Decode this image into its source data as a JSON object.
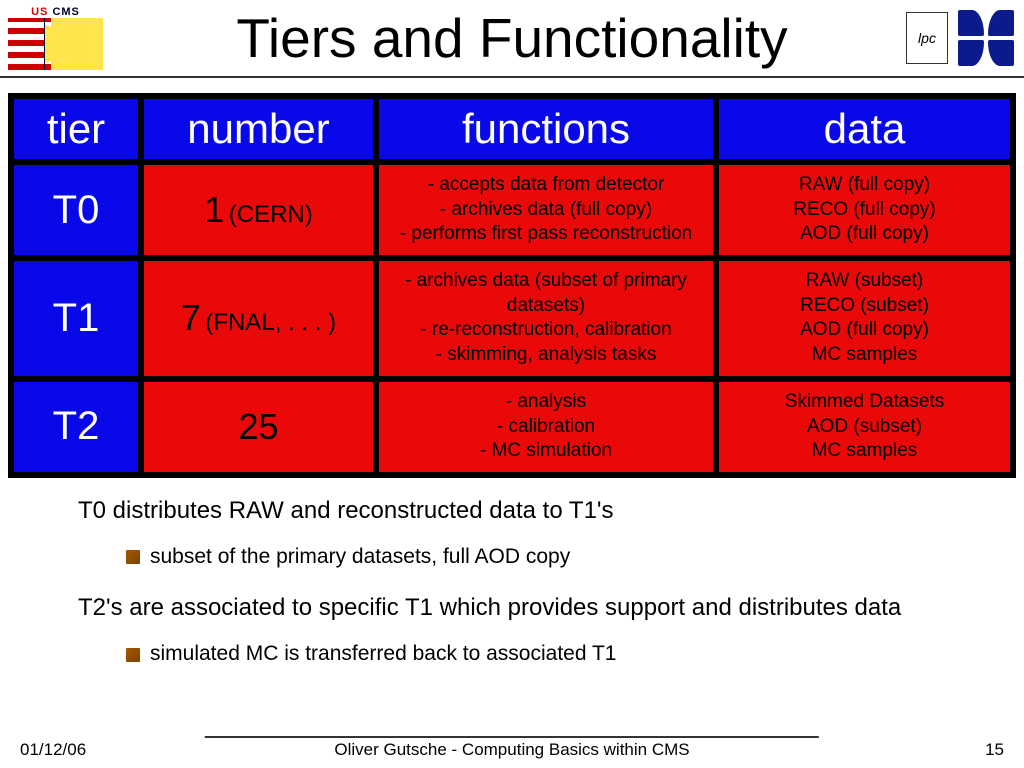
{
  "header": {
    "logo_text": "US CMS",
    "title": "Tiers and Functionality",
    "lpc": "lpc"
  },
  "table": {
    "headers": {
      "c0": "tier",
      "c1": "number",
      "c2": "functions",
      "c3": "data"
    },
    "rows": [
      {
        "tier": "T0",
        "num_main": "1",
        "num_sub": "(CERN)",
        "functions": "- accepts data from detector\n- archives data (full copy)\n- performs first pass reconstruction",
        "data": "RAW (full copy)\nRECO (full copy)\nAOD (full copy)"
      },
      {
        "tier": "T1",
        "num_main": "7",
        "num_sub": "(FNAL, . . . )",
        "functions": "- archives data (subset of primary datasets)\n- re-reconstruction, calibration\n- skimming, analysis tasks",
        "data": "RAW (subset)\nRECO (subset)\nAOD (full copy)\nMC samples"
      },
      {
        "tier": "T2",
        "num_main": "25",
        "num_sub": "",
        "functions": "- analysis\n- calibration\n- MC simulation",
        "data": "Skimmed Datasets\nAOD (subset)\nMC samples"
      }
    ]
  },
  "below": {
    "l1": "T0 distributes RAW and reconstructed data to T1's",
    "l1sub": "subset of the primary datasets, full AOD copy",
    "l2": "T2's are associated to specific T1 which provides support and distributes data",
    "l2sub": "simulated MC is transferred back to associated T1"
  },
  "footer": {
    "date": "01/12/06",
    "author": "Oliver Gutsche - Computing Basics within CMS",
    "page": "15"
  }
}
